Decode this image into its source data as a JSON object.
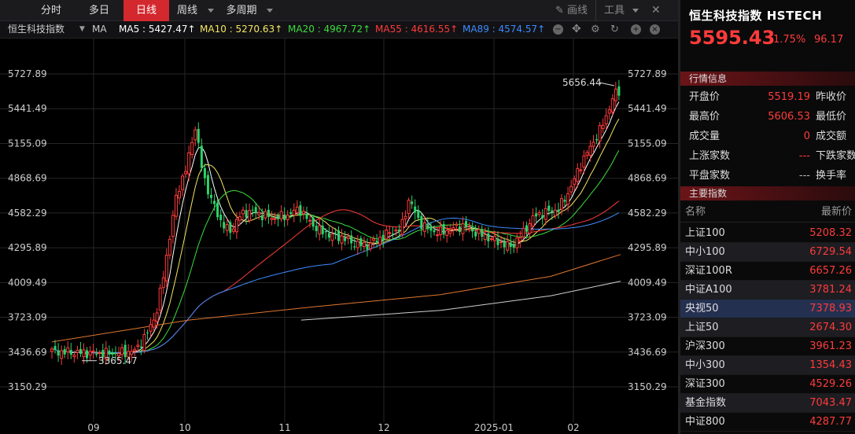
{
  "toolbar": {
    "tabs": [
      {
        "label": "分时",
        "active": false
      },
      {
        "label": "多日",
        "active": false
      },
      {
        "label": "日线",
        "active": true
      },
      {
        "label": "周线",
        "active": false
      },
      {
        "label": "多周期",
        "active": false
      }
    ],
    "draw_label": "画线",
    "tools_label": "工具"
  },
  "ma_bar": {
    "symbol": "恒生科技指数",
    "indicator": "MA",
    "ma5": "MA5 : 5427.47↑",
    "ma10": "MA10 : 5270.63↑",
    "ma20": "MA20 : 4967.72↑",
    "ma55": "MA55 : 4616.55↑",
    "ma89": "MA89 : 4574.57↑",
    "colors": {
      "ma5": "#ffffff",
      "ma10": "#f5e663",
      "ma20": "#3ddc3d",
      "ma55": "#ff3b3b",
      "ma89": "#3d8bff"
    }
  },
  "chart_data": {
    "type": "candlestick",
    "y_ticks": [
      "5727.89",
      "5441.49",
      "5155.09",
      "4868.69",
      "4582.29",
      "4295.89",
      "4009.49",
      "3723.09",
      "3436.69",
      "3150.29"
    ],
    "x_ticks": [
      "09",
      "10",
      "11",
      "12",
      "2025-01",
      "02"
    ],
    "ylim": [
      3150.29,
      5727.89
    ],
    "annotations": {
      "high": "5656.44",
      "low": "3365.47"
    },
    "colors": {
      "up": "#ff3b3b",
      "down": "#2bd46b",
      "grid": "#2a2a2a"
    }
  },
  "panel": {
    "title": "恒生科技指数 HSTECH",
    "price": "5595.43",
    "pct": "1.75%",
    "change": "96.17",
    "quote_header": "行情信息",
    "quote_rows": [
      {
        "l1": "开盘价",
        "v1": "5519.19",
        "l2": "昨收价",
        "gray": false
      },
      {
        "l1": "最高价",
        "v1": "5606.53",
        "l2": "最低价",
        "gray": false
      },
      {
        "l1": "成交量",
        "v1": "0",
        "l2": "成交额",
        "gray": false
      },
      {
        "l1": "上涨家数",
        "v1": "---",
        "l2": "下跌家数",
        "gray": false
      },
      {
        "l1": "平盘家数",
        "v1": "---",
        "l2": "换手率",
        "gray": true
      }
    ],
    "index_header": "主要指数",
    "index_cols": {
      "name": "名称",
      "price": "最新价"
    },
    "indices": [
      {
        "name": "上证100",
        "price": "5208.32"
      },
      {
        "name": "中小100",
        "price": "6729.54"
      },
      {
        "name": "深证100R",
        "price": "6657.26"
      },
      {
        "name": "中证A100",
        "price": "3781.24"
      },
      {
        "name": "央视50",
        "price": "7378.93"
      },
      {
        "name": "上证50",
        "price": "2674.30"
      },
      {
        "name": "沪深300",
        "price": "3961.23"
      },
      {
        "name": "中小300",
        "price": "1354.43"
      },
      {
        "name": "深证300",
        "price": "4529.26"
      },
      {
        "name": "基金指数",
        "price": "7043.47"
      },
      {
        "name": "中证800",
        "price": "4287.77"
      }
    ]
  }
}
